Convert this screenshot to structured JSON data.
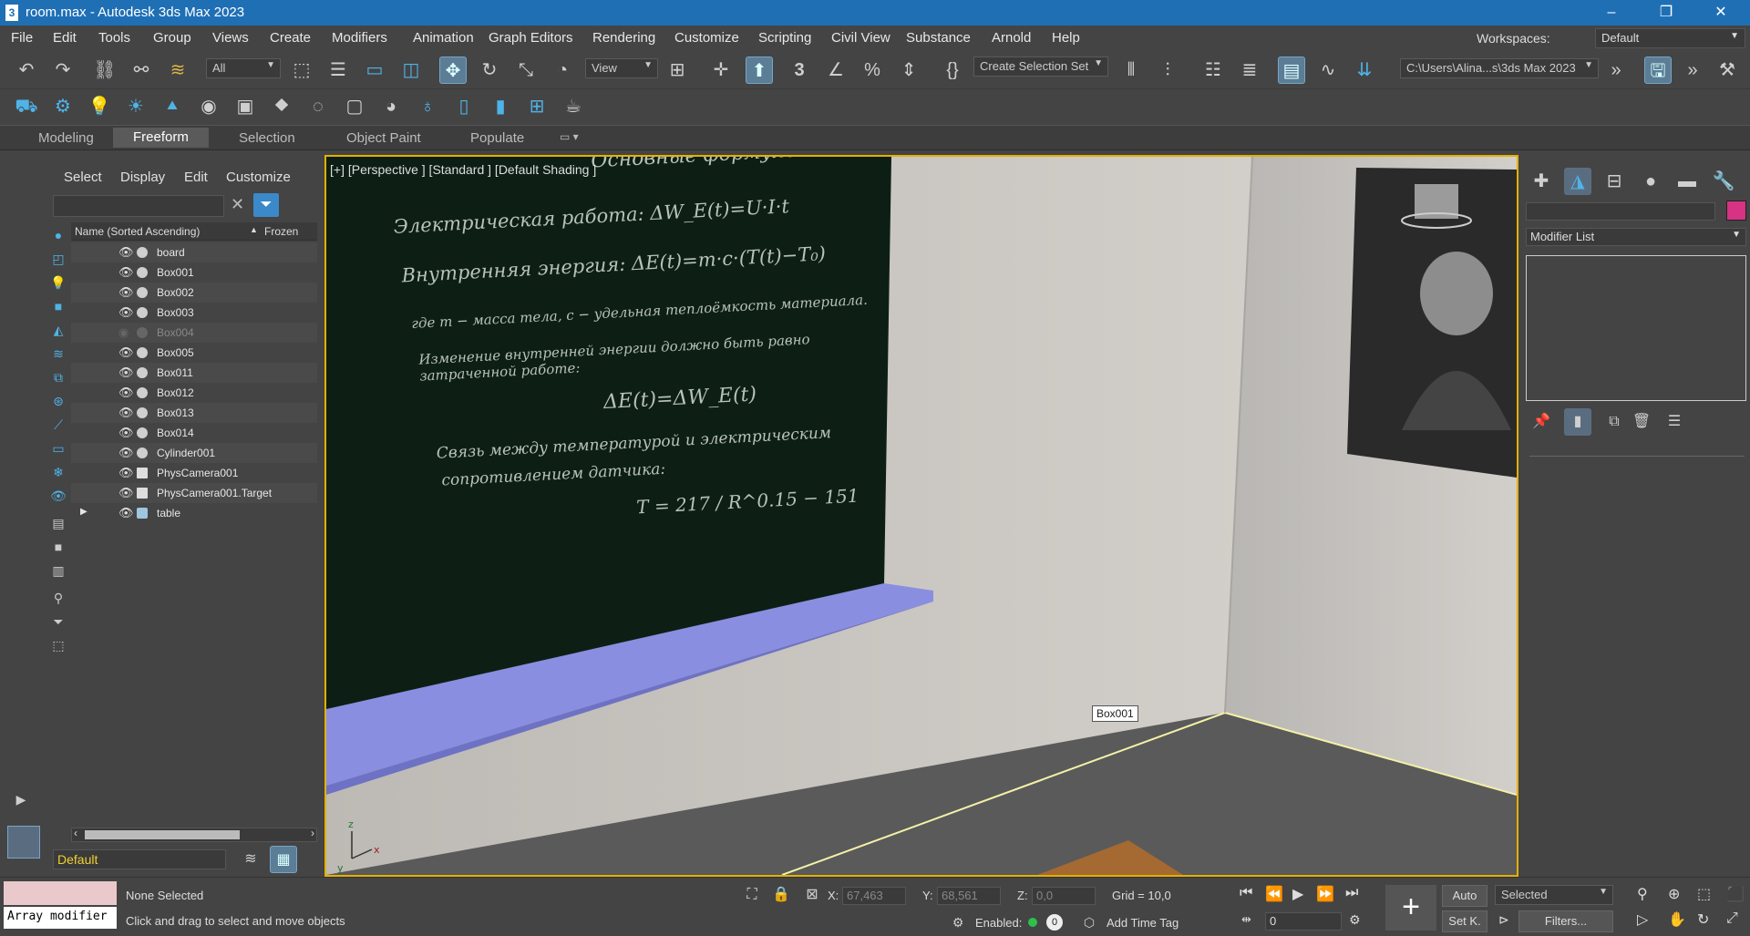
{
  "window": {
    "title": "room.max - Autodesk 3ds Max 2023",
    "icon_char": "3",
    "minimize": "–",
    "restore": "❐",
    "close": "✕"
  },
  "menu": [
    "File",
    "Edit",
    "Tools",
    "Group",
    "Views",
    "Create",
    "Modifiers",
    "Animation",
    "Graph Editors",
    "Rendering",
    "Customize",
    "Scripting",
    "Civil View",
    "Substance",
    "Arnold",
    "Help"
  ],
  "workspace": {
    "label": "Workspaces:",
    "value": "Default"
  },
  "toolbar": {
    "filter_value": "All",
    "ref_coord_value": "View",
    "selection_set_value": "Create Selection Set",
    "path_value": "C:\\Users\\Alina...s\\3ds Max 2023",
    "snap_label": "3",
    "angle_snap_label": "%"
  },
  "ribbon": {
    "tabs": [
      "Modeling",
      "Freeform",
      "Selection",
      "Object Paint",
      "Populate"
    ],
    "active": "Freeform"
  },
  "explorer": {
    "menu": [
      "Select",
      "Display",
      "Edit",
      "Customize"
    ],
    "columns": {
      "name": "Name (Sorted Ascending)",
      "sort_arrow": "▲",
      "frozen": "Frozen"
    },
    "rows": [
      {
        "name": "board"
      },
      {
        "name": "Box001"
      },
      {
        "name": "Box002"
      },
      {
        "name": "Box003"
      },
      {
        "name": "Box004"
      },
      {
        "name": "Box005"
      },
      {
        "name": "Box011"
      },
      {
        "name": "Box012"
      },
      {
        "name": "Box013"
      },
      {
        "name": "Box014"
      },
      {
        "name": "Cylinder001"
      },
      {
        "name": "PhysCamera001"
      },
      {
        "name": "PhysCamera001.Target"
      },
      {
        "name": "table"
      }
    ],
    "layer": "Default"
  },
  "viewport": {
    "label": "[+] [Perspective ] [Standard ] [Default Shading ]",
    "tooltip": "Box001",
    "board_lines": [
      "Основные формулы:",
      "Электрическая работа: ΔW_E(t)=U·I·t",
      "Внутренняя энергия: ΔE(t)=m·c·(T(t)−T₀)",
      "где m − масса тела, c − удельная теплоёмкость материала.",
      "Изменение внутренней энергии должно быть равно затраченной работе:",
      "ΔE(t)=ΔW_E(t)",
      "Связь между температурой и электрическим",
      "сопротивлением датчика:",
      "T = 217 / R^0.15 − 151"
    ]
  },
  "command_panel": {
    "modifier_list": "Modifier List",
    "color_swatch": "#d63384"
  },
  "status": {
    "script_label": "Array modifier",
    "selection": "None Selected",
    "prompt": "Click and drag to select and move objects",
    "x_label": "X:",
    "x_value": "67,463",
    "y_label": "Y:",
    "y_value": "68,561",
    "z_label": "Z:",
    "z_value": "0,0",
    "grid": "Grid = 10,0",
    "enabled_label": "Enabled:",
    "enabled_count": "0",
    "add_time_tag": "Add Time Tag",
    "auto_label": "Auto",
    "selected_value": "Selected",
    "setk_label": "Set K.",
    "filters_label": "Filters...",
    "frame_value": "0"
  },
  "colors": {
    "accent": "#1f6fb5",
    "viewport_border": "#e4b000",
    "layer_text": "#f0d030"
  }
}
